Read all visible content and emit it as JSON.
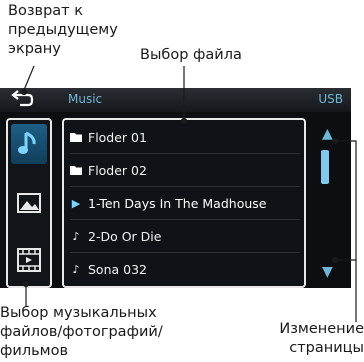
{
  "callouts": {
    "back_lines": [
      "Возврат к",
      "предыдущему",
      "экрану"
    ],
    "file_select": "Выбор файла",
    "media_lines": [
      "Выбор музыкальных",
      "файлов/фотографий/",
      "фильмов"
    ],
    "page_lines": [
      "Изменение",
      "страницы"
    ]
  },
  "topbar": {
    "title": "Music",
    "source": "USB"
  },
  "media_buttons": [
    {
      "name": "music-icon",
      "active": true
    },
    {
      "name": "photo-icon",
      "active": false
    },
    {
      "name": "video-icon",
      "active": false
    }
  ],
  "files": [
    {
      "icon": "folder-icon",
      "label": "Floder 01"
    },
    {
      "icon": "folder-icon",
      "label": "Floder 02"
    },
    {
      "icon": "play-icon",
      "label": "1-Ten Days In The Madhouse",
      "selected": true
    },
    {
      "icon": "music-note-icon",
      "label": "2-Do Or Die"
    },
    {
      "icon": "music-note-icon",
      "label": "Sona 032"
    }
  ],
  "colors": {
    "accent": "#6fb6d6",
    "selection": "#1e5f86",
    "screen_bg": "#0c0e12"
  }
}
